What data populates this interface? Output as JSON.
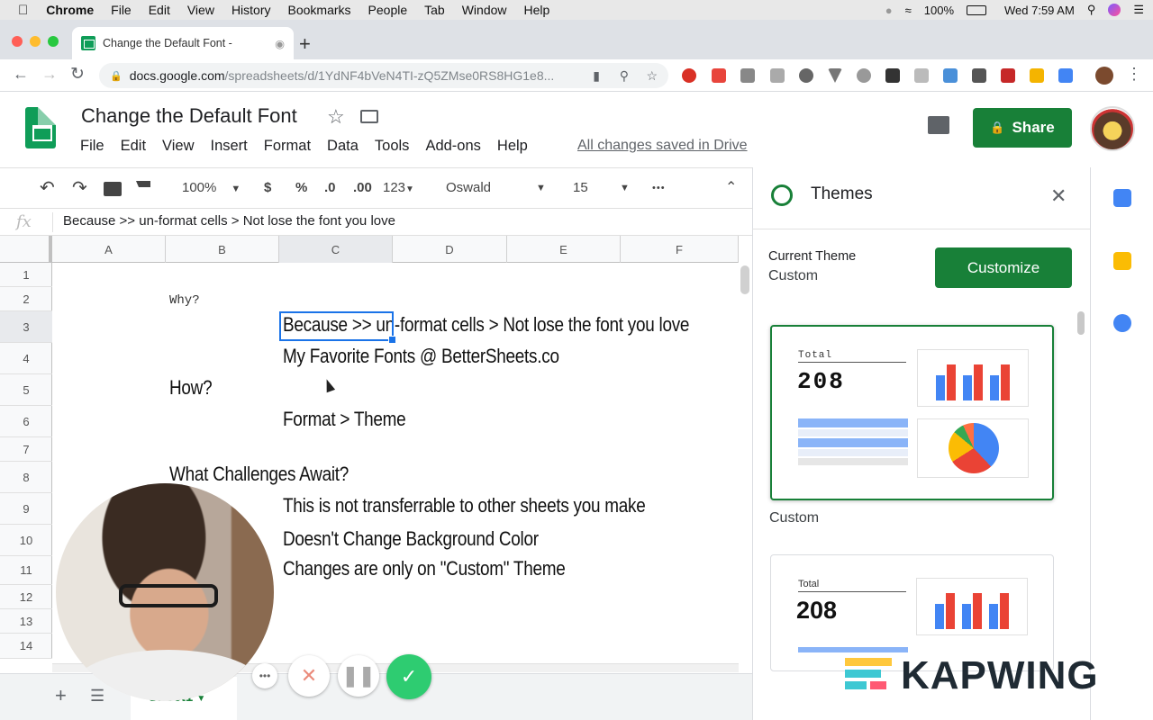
{
  "menubar": {
    "app": "Chrome",
    "items": [
      "File",
      "Edit",
      "View",
      "History",
      "Bookmarks",
      "People",
      "Tab",
      "Window",
      "Help"
    ],
    "battery": "100%",
    "clock": "Wed 7:59 AM"
  },
  "browser": {
    "tab_title": "Change the Default Font -",
    "url_host": "docs.google.com",
    "url_path": "/spreadsheets/d/1YdNF4bVeN4TI-zQ5ZMse0RS8HG1e8..."
  },
  "docs": {
    "title": "Change the Default Font",
    "menu": [
      "File",
      "Edit",
      "View",
      "Insert",
      "Format",
      "Data",
      "Tools",
      "Add-ons",
      "Help"
    ],
    "saved_status": "All changes saved in Drive",
    "share_label": "Share"
  },
  "toolbar": {
    "zoom": "100%",
    "currency": "$",
    "percent": "%",
    "dec_less": ".0",
    "dec_more": ".00",
    "format_more": "123",
    "font": "Oswald",
    "font_size": "15",
    "more": "•••"
  },
  "formula_bar": {
    "fx": "fx",
    "value": "Because >> un-format cells > Not lose the font you love"
  },
  "grid": {
    "columns": [
      "A",
      "B",
      "C",
      "D",
      "E",
      "F"
    ],
    "rows": [
      "1",
      "2",
      "3",
      "4",
      "5",
      "6",
      "7",
      "8",
      "9",
      "10",
      "11",
      "12",
      "13",
      "14"
    ],
    "cells": {
      "b2": "Why?",
      "c3": "Because >> un-format cells > Not lose the font you love",
      "c4": "My Favorite Fonts @ BetterSheets.co",
      "b5": "How?",
      "c6": "Format > Theme",
      "b8": "What Challenges Await?",
      "c9": "This is not transferrable to other sheets you make",
      "c10": "Doesn't Change Background Color",
      "c11": "Changes are only on \"Custom\" Theme"
    }
  },
  "sheet_tab": "Sheet1",
  "themes_panel": {
    "title": "Themes",
    "current_label": "Current Theme",
    "current_value": "Custom",
    "customize_label": "Customize",
    "cards": [
      {
        "name": "Custom",
        "total_label": "Total",
        "total_value": "208"
      },
      {
        "name": "",
        "total_label": "Total",
        "total_value": "208"
      }
    ]
  },
  "watermark": "KAPWING",
  "colors": {
    "sheets_green": "#188038",
    "selection_blue": "#1a73e8",
    "chart_blue": "#4285f4",
    "chart_red": "#ea4335",
    "chart_yellow": "#fbbc04",
    "chart_green": "#34a853"
  }
}
